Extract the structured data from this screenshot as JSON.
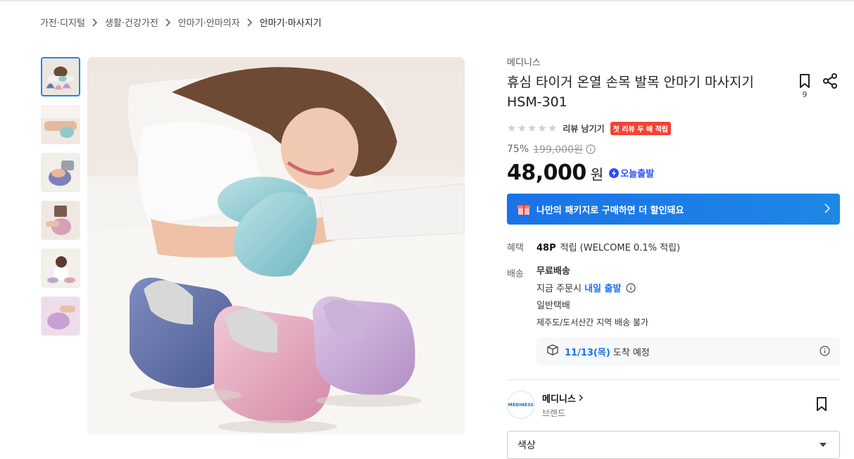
{
  "breadcrumb": [
    {
      "label": "가전·디지털"
    },
    {
      "label": "생활·건강가전"
    },
    {
      "label": "안마기·안마의자"
    },
    {
      "label": "안마기·마사지기"
    }
  ],
  "gallery": {
    "thumbnail_count": 6,
    "active_index": 0,
    "main_image": "massager-product-photo"
  },
  "product": {
    "brand": "메디니스",
    "title": "휴심 타이거 온열 손목 발목 안마기 마사지기 HSM-301",
    "bookmark_count": "9",
    "rating": {
      "stars": 0,
      "max_stars": 5,
      "review_link": "리뷰 남기기",
      "badge": "첫 리뷰 두 배 적립"
    },
    "discount": "75%",
    "original_price": "199,000원",
    "price": "48,000",
    "currency": "원",
    "delivery_badge": "오늘출발"
  },
  "package_banner": {
    "text": "나만의 패키지로 구매하면 더 할인돼요"
  },
  "benefit": {
    "label": "혜택",
    "points": "48P",
    "points_text": "적립 (WELCOME 0.1% 적립)"
  },
  "shipping": {
    "label": "배송",
    "fee": "무료배송",
    "order_prefix": "지금 주문시",
    "dispatch": "내일 출발",
    "method": "일반택배",
    "restriction": "제주도/도서산간 지역 배송 불가",
    "arrival_date": "11/13(목)",
    "arrival_text": "도착 예정"
  },
  "store": {
    "logo_text": "MEDINESS",
    "name": "메디니스",
    "type": "브랜드"
  },
  "option": {
    "label": "색상"
  },
  "colors": {
    "accent": "#1a73e8",
    "badge_red": "#f44336",
    "today_blue": "#2b4dff"
  }
}
